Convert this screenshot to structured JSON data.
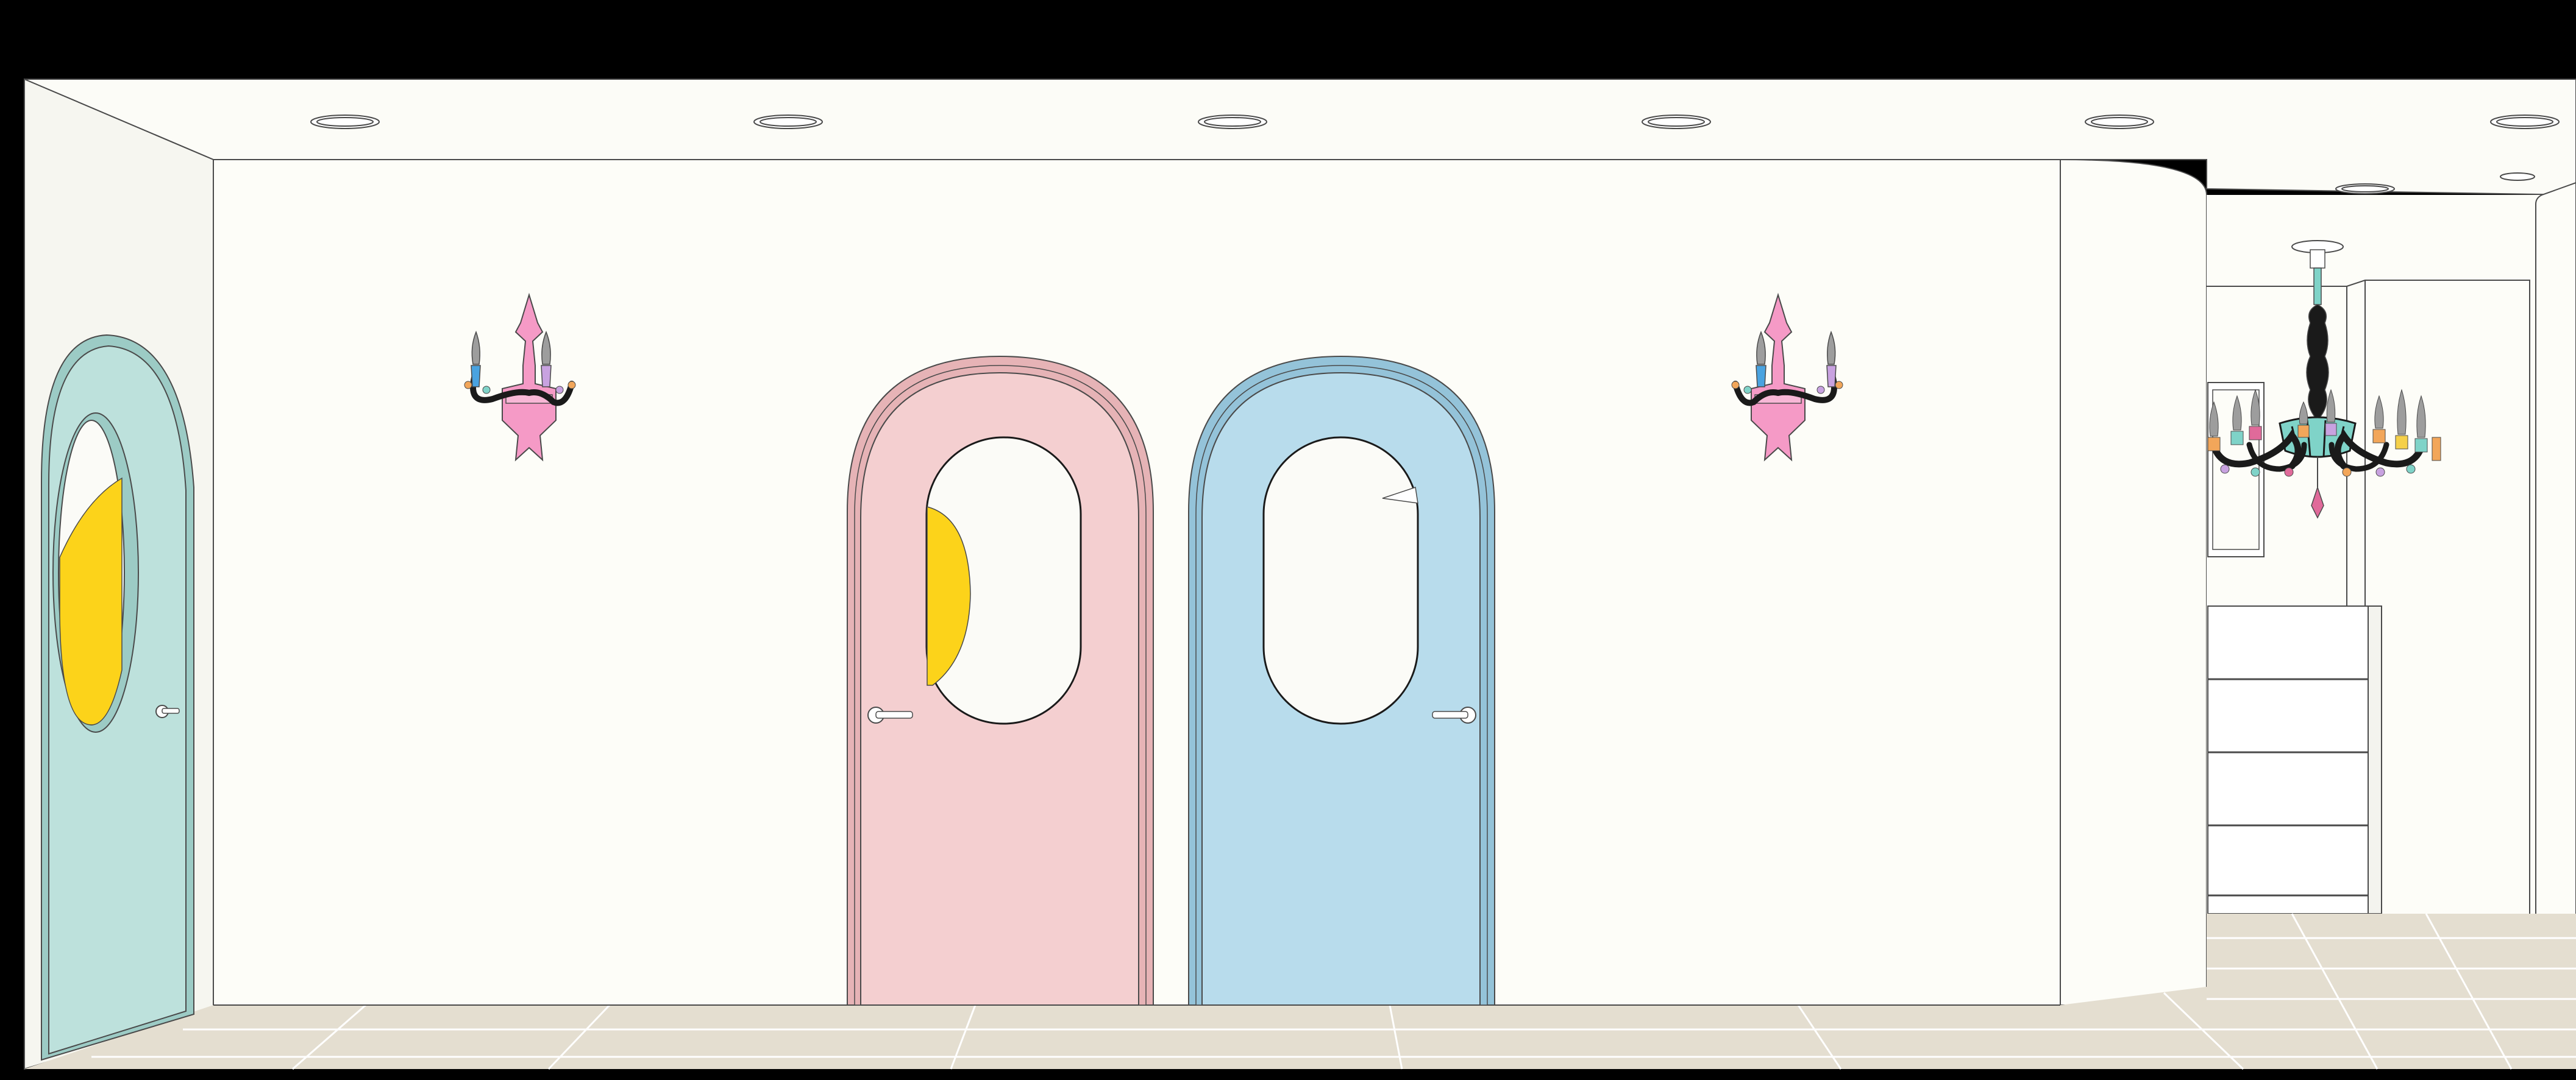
{
  "scene": {
    "colors": {
      "frame": "#000000",
      "ceiling": "#fcfcf7",
      "wall": "#fdfdf8",
      "wall_shadow": "#f6f6f0",
      "floor": "#e4ded0",
      "floor_lines": "#ffffff",
      "outline": "#4a4a4a",
      "door_mint": "#bde1dc",
      "door_mint_dark": "#9ccbc5",
      "door_pink": "#f4cfd0",
      "door_pink_dark": "#e6b3b6",
      "door_blue": "#b8dcec",
      "door_blue_dark": "#94c3d9",
      "window_glass": "#fbfbf7",
      "window_yellow": "#fcd31a",
      "sconce_pink": "#f59ac6",
      "chandelier_dark": "#1a1a1a",
      "candle_gray": "#9d9d9d"
    },
    "icons": [
      "ceiling-light-icon",
      "wall-sconce-icon",
      "chandelier-icon",
      "door-handle-icon",
      "shelf-icon"
    ]
  }
}
